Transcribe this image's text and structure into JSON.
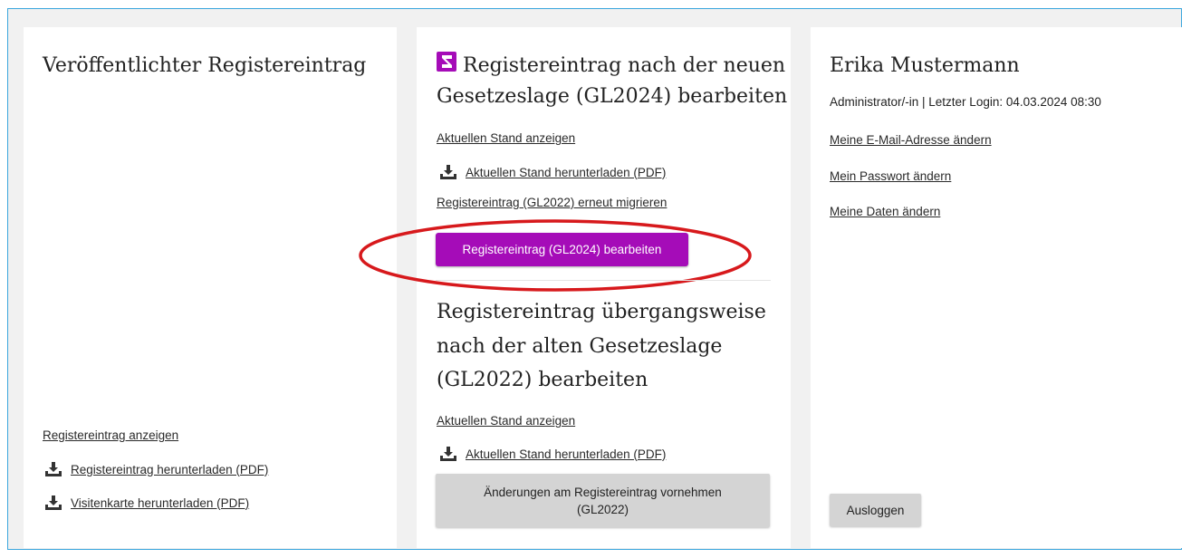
{
  "published": {
    "title": "Veröffentlichter Registereintrag",
    "show_link": "Registereintrag anzeigen",
    "download_link": "Registereintrag herunterladen (PDF)",
    "card_link": "Visitenkarte herunterladen (PDF)"
  },
  "new_law": {
    "title_line1": "Registereintrag nach der neuen",
    "title_line2": "Gesetzeslage (GL2024) bearbeiten",
    "show_link": "Aktuellen Stand anzeigen",
    "download_link": "Aktuellen Stand herunterladen (PDF)",
    "migrate_link": "Registereintrag (GL2022) erneut migrieren",
    "edit_button": "Registereintrag (GL2024) bearbeiten"
  },
  "old_law": {
    "title_line1": "Registereintrag übergangsweise",
    "title_line2": "nach der alten Gesetzeslage",
    "title_line3": "(GL2022) bearbeiten",
    "show_link": "Aktuellen Stand anzeigen",
    "download_link": "Aktuellen Stand herunterladen (PDF)",
    "edit_button_line1": "Änderungen am Registereintrag vornehmen",
    "edit_button_line2": "(GL2022)"
  },
  "user": {
    "name": "Erika Mustermann",
    "meta": "Administrator/-in | Letzter Login: 04.03.2024  08:30",
    "email_link": "Meine E-Mail-Adresse ändern",
    "password_link": "Mein Passwort ändern",
    "data_link": "Meine Daten ändern",
    "logout_button": "Ausloggen"
  },
  "colors": {
    "accent": "#a50cb8",
    "frame_border": "#3aa6dd",
    "highlight": "#d7191c"
  },
  "icons": {
    "download": "download-icon",
    "logo": "app-logo-icon"
  }
}
